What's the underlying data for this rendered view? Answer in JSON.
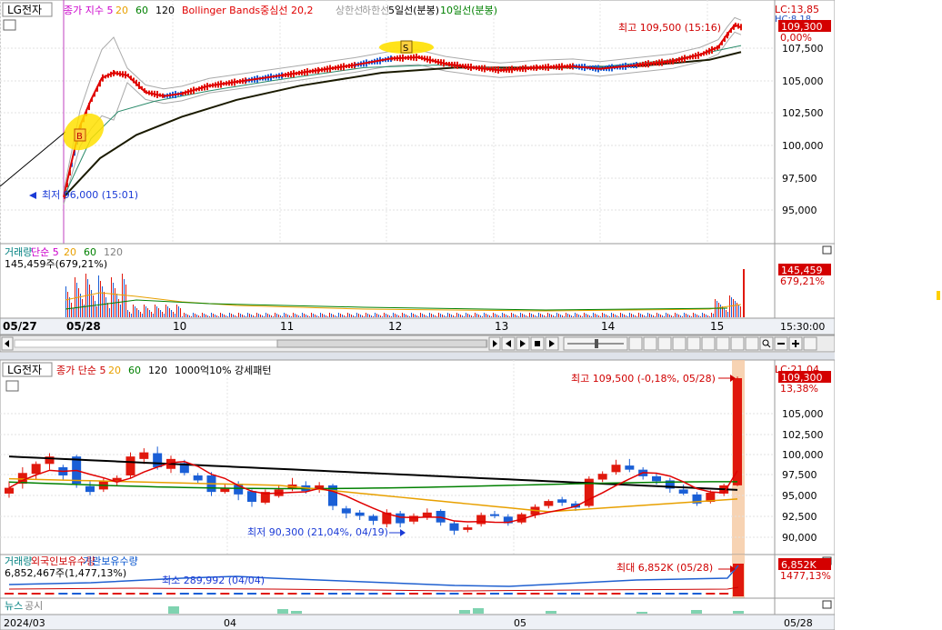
{
  "top_chart": {
    "symbol": "LG전자",
    "legend": [
      {
        "text": "종가 지수 5",
        "color": "#cc00cc"
      },
      {
        "text": "20",
        "color": "#e8a000"
      },
      {
        "text": "60",
        "color": "#008000"
      },
      {
        "text": "120",
        "color": "#000000"
      },
      {
        "text": "Bollinger Bands중심선 20,2",
        "color": "#e00000"
      },
      {
        "text": "상한선",
        "color": "#999999"
      },
      {
        "text": "하한선",
        "color": "#999999"
      },
      {
        "text": "5일선(분봉)",
        "color": "#000000"
      },
      {
        "text": "10일선(분봉)",
        "color": "#008000"
      }
    ],
    "lc_label": "LC:13,85",
    "hc_label": "HC:8,18",
    "price_axis": [
      "107,500",
      "105,000",
      "102,500",
      "100,000",
      "97,500",
      "95,000"
    ],
    "current_price": "109,300",
    "change_pct": "0,00%",
    "high_annotation": "최고 109,500 (15:16)",
    "low_annotation": "최저 96,000 (15:01)",
    "buy_marker": "B",
    "sell_marker": "S"
  },
  "volume_pane": {
    "legend": [
      {
        "text": "거래량",
        "color": "#008080"
      },
      {
        "text": "단순 5",
        "color": "#cc00cc"
      },
      {
        "text": "20",
        "color": "#e8a000"
      },
      {
        "text": "60",
        "color": "#008000"
      },
      {
        "text": "120",
        "color": "#808080"
      }
    ],
    "summary": "145,459주(679,21%)",
    "value_box": "145,459",
    "pct_box": "679,21%"
  },
  "top_time_axis": {
    "labels": [
      "05/27",
      "05/28",
      "10",
      "11",
      "12",
      "13",
      "14",
      "15"
    ],
    "current_time": "15:30:00"
  },
  "bottom_chart": {
    "symbol": "LG전자",
    "legend": [
      {
        "text": "종가 단순 5",
        "color": "#cc0000"
      },
      {
        "text": "20",
        "color": "#e8a000"
      },
      {
        "text": "60",
        "color": "#008000"
      },
      {
        "text": "120",
        "color": "#000000"
      },
      {
        "text": "1000억10% 강세패턴",
        "color": "#000000"
      }
    ],
    "lc_label": "LC:21,04",
    "price_axis": [
      "105,000",
      "102,500",
      "100,000",
      "97,500",
      "95,000",
      "92,500",
      "90,000"
    ],
    "current_price": "109,300",
    "change_pct": "13,38%",
    "high_annotation": "최고 109,500 (-0,18%, 05/28)",
    "low_annotation": "최저 90,300 (21,04%, 04/19)"
  },
  "bottom_volume": {
    "legend": [
      {
        "text": "거래량",
        "color": "#008080"
      },
      {
        "text": "외국인보유수량",
        "color": "#cc0000"
      },
      {
        "text": "기관보유수량",
        "color": "#0050cc"
      }
    ],
    "summary": "6,852,467주(1,477,13%)",
    "min_annotation": "최소 289,992 (04/04)",
    "max_annotation": "최대 6,852K (05/28)",
    "value_box": "6,852K",
    "pct_box": "1477,13%"
  },
  "news_pane": {
    "legend": [
      {
        "text": "뉴스",
        "color": "#008080"
      },
      {
        "text": "공시",
        "color": "#808080"
      }
    ]
  },
  "bottom_time_axis": {
    "labels": [
      "2024/03",
      "04",
      "05"
    ],
    "current": "05/28"
  },
  "colors": {
    "up": "#e0180c",
    "down": "#1a5fd6",
    "ma_red": "#e00000",
    "ma_black": "#000000",
    "ma_orange": "#e8a000",
    "ma_green": "#008000",
    "highlight_yellow": "#ffe000"
  }
}
